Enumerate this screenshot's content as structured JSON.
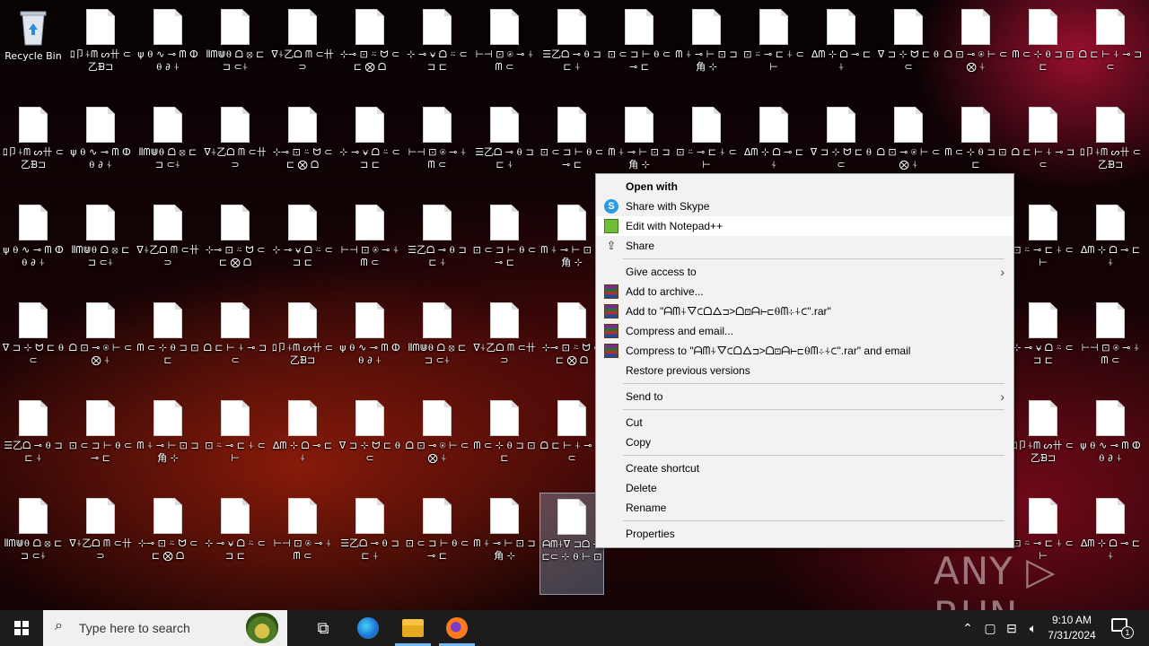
{
  "desktop": {
    "recycle_bin_label": "Recycle Bin",
    "files": [
      {
        "label": "ﾛ卩⍭ᗰ ᔕ卄 ⊂乙ᗿ⊐"
      },
      {
        "label": "ψ ⍬ ∿ ⊸ ᗰ ⵀ ⍬ ∂ ⍭"
      },
      {
        "label": "⦀ᗰ⋓⍬ ᗝ ⦻ ⊏ ⊐ ⊂⍭"
      },
      {
        "label": "ᐁ⍭乙ᗝ ᗰ ⊂卄 ⊃"
      },
      {
        "label": "⊹⊸ ⊡ ⍨ ᗢ ⊂ ⊏ ⨂ ᗝ"
      },
      {
        "label": "⊹ ⊸ ⍱ ᗝ ⍨ ⊂ ⊐ ⊏"
      },
      {
        "label": "⊢⊣ ⊡ ⍟ ⊸ ⍭ ᗰ ⊂"
      },
      {
        "label": "☰乙ᗝ ⊸ ⍬ ⊐ ⊏ ⍭"
      },
      {
        "label": "⊡ ⊂ ⊐ ⊢ ⍬ ⊂ ⊸ ⊏"
      },
      {
        "label": "ᗰ ⍭ ⊸ ⊢ ⊡ ⊐ 角 ⊹"
      },
      {
        "label": "⊡ ⍨ ⊸ ⊏ ⍭ ⊂ ⊢"
      },
      {
        "label": "ᐃᗰ ⊹ ᗝ ⊸ ⊏ ⍭"
      },
      {
        "label": "ᐁ ⊐ ⊹ ᗢ ⊏ ⍬ ⊂"
      },
      {
        "label": "ᗝ ⊡ ⊸ ⍟ ⊢ ⊂ ⨂ ⍭"
      },
      {
        "label": "ᗰ ⊂ ⊹ ⍬ ⊐ ⊡ ⊏"
      },
      {
        "label": "ᗝ ⊏ ⊢ ⍭ ⊸ ⊐ ⊂"
      }
    ],
    "selected_file_label": "ᗩᗰ⍭ᐁ ⊐ᗝ ⊸⊏⊂ ⊹ ⍬ ⊢ ⊡"
  },
  "context_menu": {
    "items": {
      "open": "Open with",
      "skype": "Share with Skype",
      "notepad": "Edit with Notepad++",
      "share": "Share",
      "give_access": "Give access to",
      "add_archive": "Add to archive...",
      "add_to_rar": "Add to \"ᗩᗰ⍭ᐁ⊂ᗝᐃ⊐>ᗝ⊡ᗩ⊢⊏⍬ᗰ⊹⍭⊂\".rar\"",
      "compress_email": "Compress and email...",
      "compress_rar_email": "Compress to \"ᗩᗰ⍭ᐁ⊂ᗝᐃ⊐>ᗝ⊡ᗩ⊢⊏⍬ᗰ⊹⍭⊂\".rar\" and email",
      "restore": "Restore previous versions",
      "send_to": "Send to",
      "cut": "Cut",
      "copy": "Copy",
      "create_shortcut": "Create shortcut",
      "delete": "Delete",
      "rename": "Rename",
      "properties": "Properties"
    }
  },
  "watermark": "ANY ▷ RUN",
  "taskbar": {
    "search_placeholder": "Type here to search",
    "time": "9:10 AM",
    "date": "7/31/2024",
    "notification_count": "1"
  },
  "icons": {
    "recycle_bin": "recycle-bin-icon",
    "file": "blank-file-icon",
    "skype": "skype-icon",
    "notepad": "notepad-plus-plus-icon",
    "share": "share-icon",
    "winrar": "winrar-icon",
    "start": "windows-start-icon",
    "search": "search-icon",
    "task_view": "task-view-icon",
    "edge": "edge-icon",
    "explorer": "file-explorer-icon",
    "firefox": "firefox-icon"
  },
  "colors": {
    "menu_background": "#f2f2f2",
    "menu_highlight": "#ffffff",
    "taskbar": "#1c1c1c",
    "selection": "#99b4d2"
  }
}
